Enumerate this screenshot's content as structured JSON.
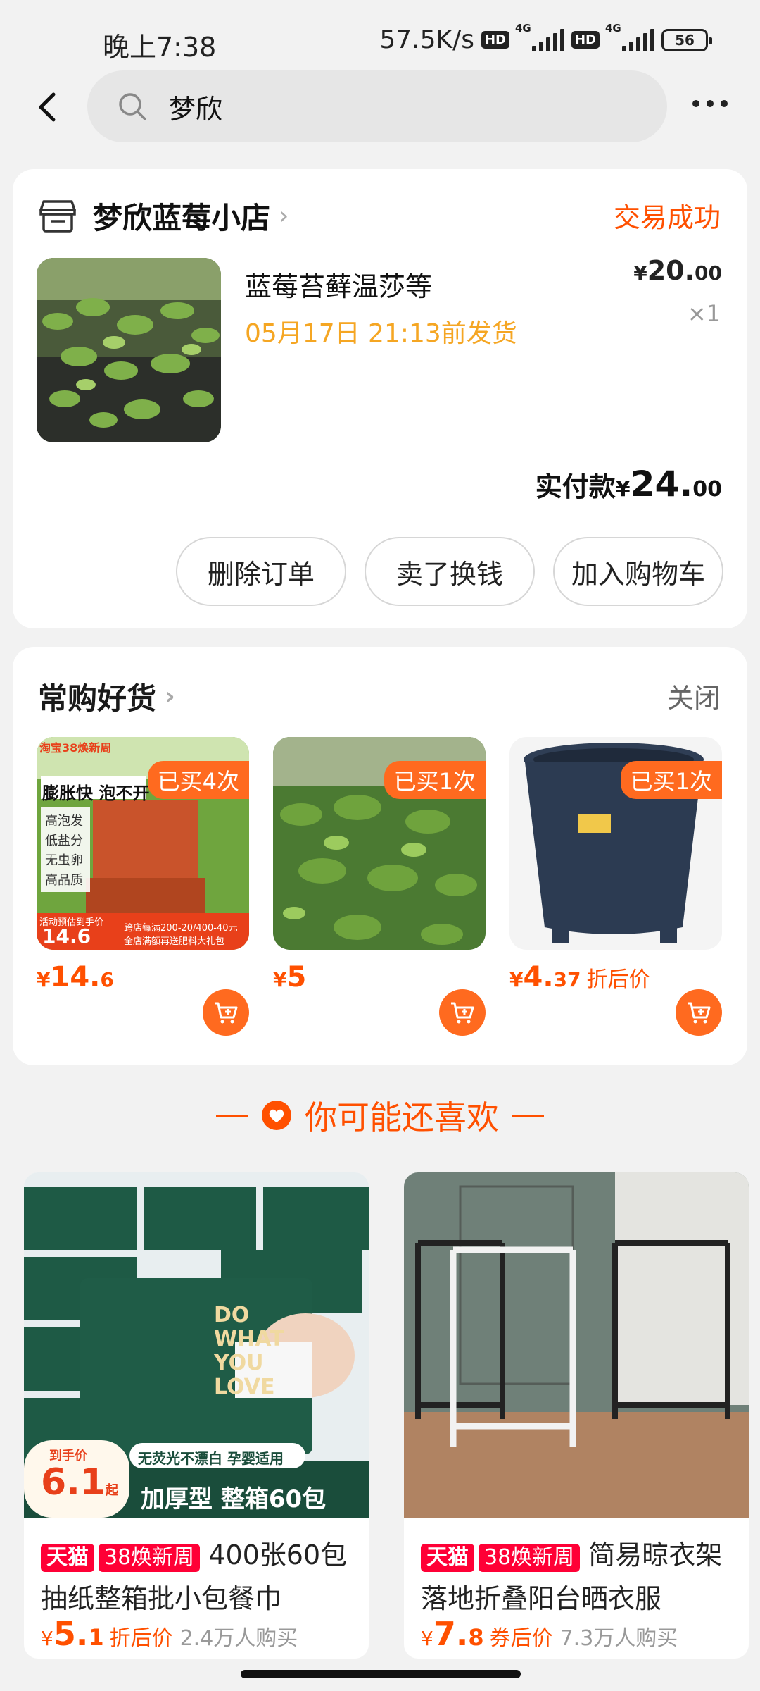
{
  "status_bar": {
    "time": "晚上7:38",
    "net_speed": "57.5K/s",
    "hd": "HD",
    "net_type": "4G",
    "battery": "56"
  },
  "nav": {
    "search_value": "梦欣"
  },
  "order": {
    "shop_name": "梦欣蓝莓小店",
    "status": "交易成功",
    "product_title": "蓝莓苔藓温莎等",
    "ship_time": "05月17日 21:13前发货",
    "price_symbol": "¥",
    "price_int": "20.",
    "price_dec": "00",
    "quantity": "×1",
    "paid_label": "实付款",
    "paid_symbol": "¥",
    "paid_int": "24.",
    "paid_dec": "00",
    "buttons": [
      "删除订单",
      "卖了换钱",
      "加入购物车"
    ]
  },
  "favorites": {
    "title": "常购好货",
    "close": "关闭",
    "items": [
      {
        "badge": "已买4次",
        "price_symbol": "¥",
        "price": "14.",
        "price_dec": "6",
        "suffix": "",
        "img_text": {
          "top": "淘宝38焕新周",
          "line1": "膨胀快 泡不开",
          "f1": "高泡发",
          "f2": "低盐分",
          "f3": "无虫卵",
          "f4": "高品质",
          "deal_label": "活动预估到手价",
          "deal_price": "14.6",
          "note1": "跨店每满200-20/400-40元",
          "note2": "全店满额再送肥料大礼包"
        }
      },
      {
        "badge": "已买1次",
        "price_symbol": "¥",
        "price": "5",
        "price_dec": "",
        "suffix": ""
      },
      {
        "badge": "已买1次",
        "price_symbol": "¥",
        "price": "4.",
        "price_dec": "37",
        "suffix": "折后价"
      }
    ]
  },
  "recommend": {
    "title": "你可能还喜欢",
    "items": [
      {
        "tag1": "天猫",
        "tag2": "38焕新周",
        "title": "400张60包抽纸整箱批小包餐巾",
        "price_symbol": "¥",
        "price": "5.",
        "price_dec": "1",
        "price_label": "折后价",
        "sold": "2.4万人购买",
        "img_text": {
          "deal": "到手价",
          "deal_price": "6.1",
          "deal_unit": "起",
          "slogan": "无荧光不漂白 孕婴适用",
          "banner": "加厚型 整箱60包",
          "brand": "DO WHAT YOU LOVE"
        }
      },
      {
        "tag1": "天猫",
        "tag2": "38焕新周",
        "title": "简易晾衣架落地折叠阳台晒衣服",
        "price_symbol": "¥",
        "price": "7.",
        "price_dec": "8",
        "price_label": "券后价",
        "sold": "7.3万人购买"
      }
    ]
  },
  "colors": {
    "accent": "#ff5000",
    "badge": "#ff6a1f",
    "tmall_red": "#ff0036",
    "ship_time": "#f5a623"
  }
}
